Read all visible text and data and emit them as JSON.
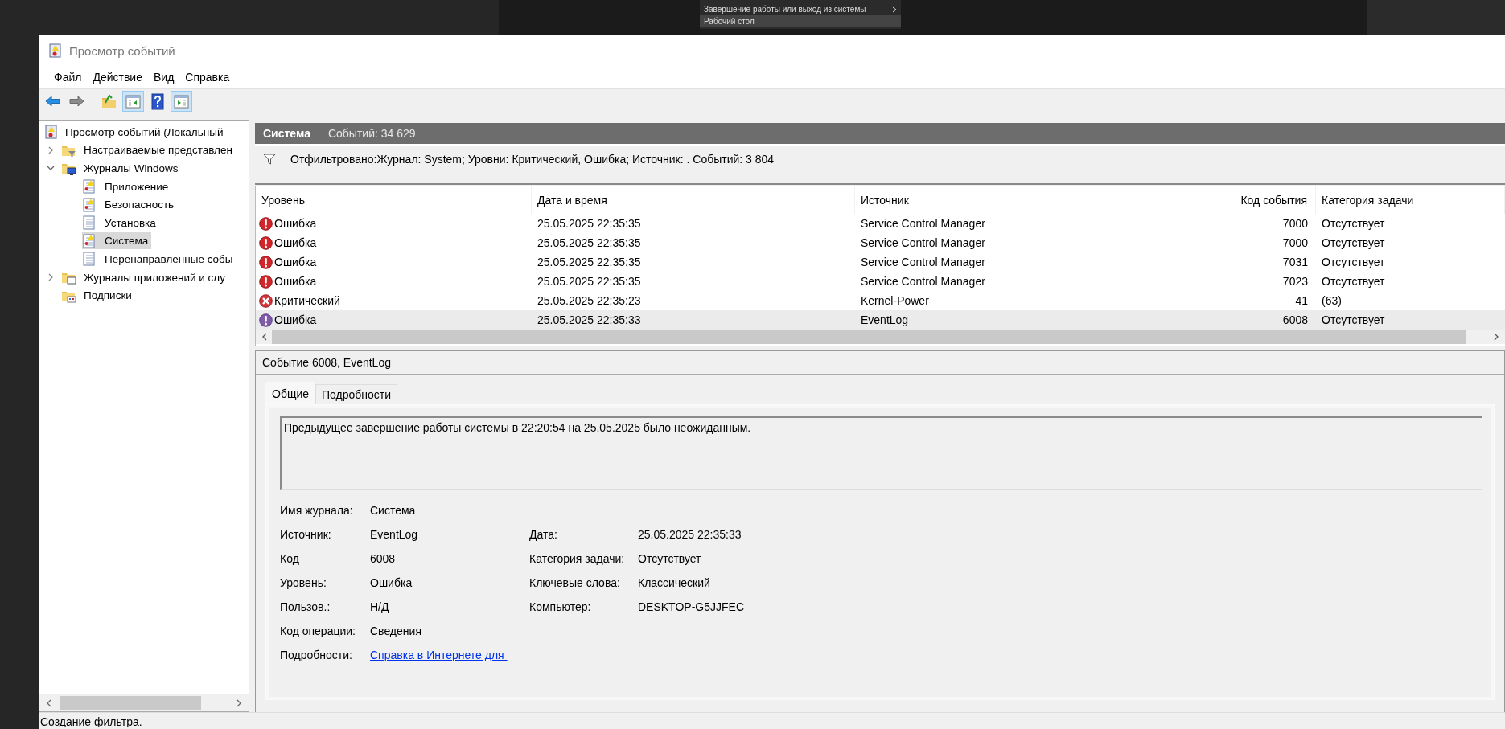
{
  "start_menu": {
    "items": [
      {
        "label": "Завершение работы или выход из системы",
        "submenu": true,
        "selected": false
      },
      {
        "label": "Рабочий стол",
        "submenu": false,
        "selected": true
      }
    ]
  },
  "window": {
    "title": "Просмотр событий"
  },
  "menu": [
    "Файл",
    "Действие",
    "Вид",
    "Справка"
  ],
  "toolbar": [
    {
      "kind": "back",
      "on": false
    },
    {
      "kind": "forward",
      "on": false
    },
    {
      "kind": "separator"
    },
    {
      "kind": "folder-up",
      "on": false
    },
    {
      "kind": "pane-left",
      "on": true
    },
    {
      "kind": "help",
      "on": false
    },
    {
      "kind": "pane-right",
      "on": true
    }
  ],
  "tree": [
    {
      "label": "Просмотр событий (Локальный",
      "kind": "root",
      "selected": false,
      "children": [
        {
          "label": "Настраиваемые представлен",
          "kind": "filter-folder",
          "expanded": false,
          "selected": false
        },
        {
          "label": "Журналы Windows",
          "kind": "windows-folder",
          "expanded": true,
          "selected": false,
          "children": [
            {
              "label": "Приложение",
              "kind": "log",
              "selected": false
            },
            {
              "label": "Безопасность",
              "kind": "log",
              "selected": false
            },
            {
              "label": "Установка",
              "kind": "plain-log",
              "selected": false
            },
            {
              "label": "Система",
              "kind": "log",
              "selected": true
            },
            {
              "label": "Перенаправленные собы",
              "kind": "plain-log",
              "selected": false
            }
          ]
        },
        {
          "label": "Журналы приложений и слу",
          "kind": "app-folder",
          "expanded": false,
          "selected": false
        },
        {
          "label": "Подписки",
          "kind": "subscriptions",
          "selected": false
        }
      ]
    }
  ],
  "log_header": {
    "title": "Система",
    "count": "Событий: 34 629"
  },
  "filter": {
    "text": "Отфильтровано:Журнал: System; Уровни: Критический, Ошибка; Источник: . Событий: 3 804"
  },
  "table": {
    "columns": [
      "Уровень",
      "Дата и время",
      "Источник",
      "Код события",
      "Категория задачи"
    ],
    "rows": [
      {
        "kind": "error",
        "level": "Ошибка",
        "date": "25.05.2025 22:35:35",
        "source": "Service Control Manager",
        "code": "7000",
        "category": "Отсутствует",
        "selected": false
      },
      {
        "kind": "error",
        "level": "Ошибка",
        "date": "25.05.2025 22:35:35",
        "source": "Service Control Manager",
        "code": "7000",
        "category": "Отсутствует",
        "selected": false
      },
      {
        "kind": "error",
        "level": "Ошибка",
        "date": "25.05.2025 22:35:35",
        "source": "Service Control Manager",
        "code": "7031",
        "category": "Отсутствует",
        "selected": false
      },
      {
        "kind": "error",
        "level": "Ошибка",
        "date": "25.05.2025 22:35:35",
        "source": "Service Control Manager",
        "code": "7023",
        "category": "Отсутствует",
        "selected": false
      },
      {
        "kind": "critical",
        "level": "Критический",
        "date": "25.05.2025 22:35:23",
        "source": "Kernel-Power",
        "code": "41",
        "category": "(63)",
        "selected": false
      },
      {
        "kind": "error",
        "level": "Ошибка",
        "date": "25.05.2025 22:35:33",
        "source": "EventLog",
        "code": "6008",
        "category": "Отсутствует",
        "selected": true
      }
    ]
  },
  "event": {
    "title": "Событие 6008, EventLog",
    "tabs": [
      {
        "label": "Общие",
        "selected": true
      },
      {
        "label": "Подробности",
        "selected": false
      }
    ],
    "message": "Предыдущее завершение работы системы в 22:20:54 на 25.05.2025 было неожиданным.",
    "fields_left": [
      {
        "label": "Имя журнала:",
        "value": "Система",
        "kind": "text"
      },
      {
        "label": "Источник:",
        "value": "EventLog",
        "kind": "text"
      },
      {
        "label": "Код",
        "value": "6008",
        "kind": "text"
      },
      {
        "label": "Уровень:",
        "value": "Ошибка",
        "kind": "text"
      },
      {
        "label": "Пользов.:",
        "value": "Н/Д",
        "kind": "text"
      },
      {
        "label": "Код операции:",
        "value": "Сведения",
        "kind": "text"
      },
      {
        "label": "Подробности:",
        "value": "Справка в Интернете для ",
        "kind": "link"
      }
    ],
    "fields_right": [
      {
        "label": "Дата:",
        "value": "25.05.2025 22:35:33"
      },
      {
        "label": "Категория задачи:",
        "value": "Отсутствует"
      },
      {
        "label": "Ключевые слова:",
        "value": "Классический"
      },
      {
        "label": "Компьютер:",
        "value": "DESKTOP-G5JJFEC"
      }
    ]
  },
  "status_bar": "Создание фильтра."
}
